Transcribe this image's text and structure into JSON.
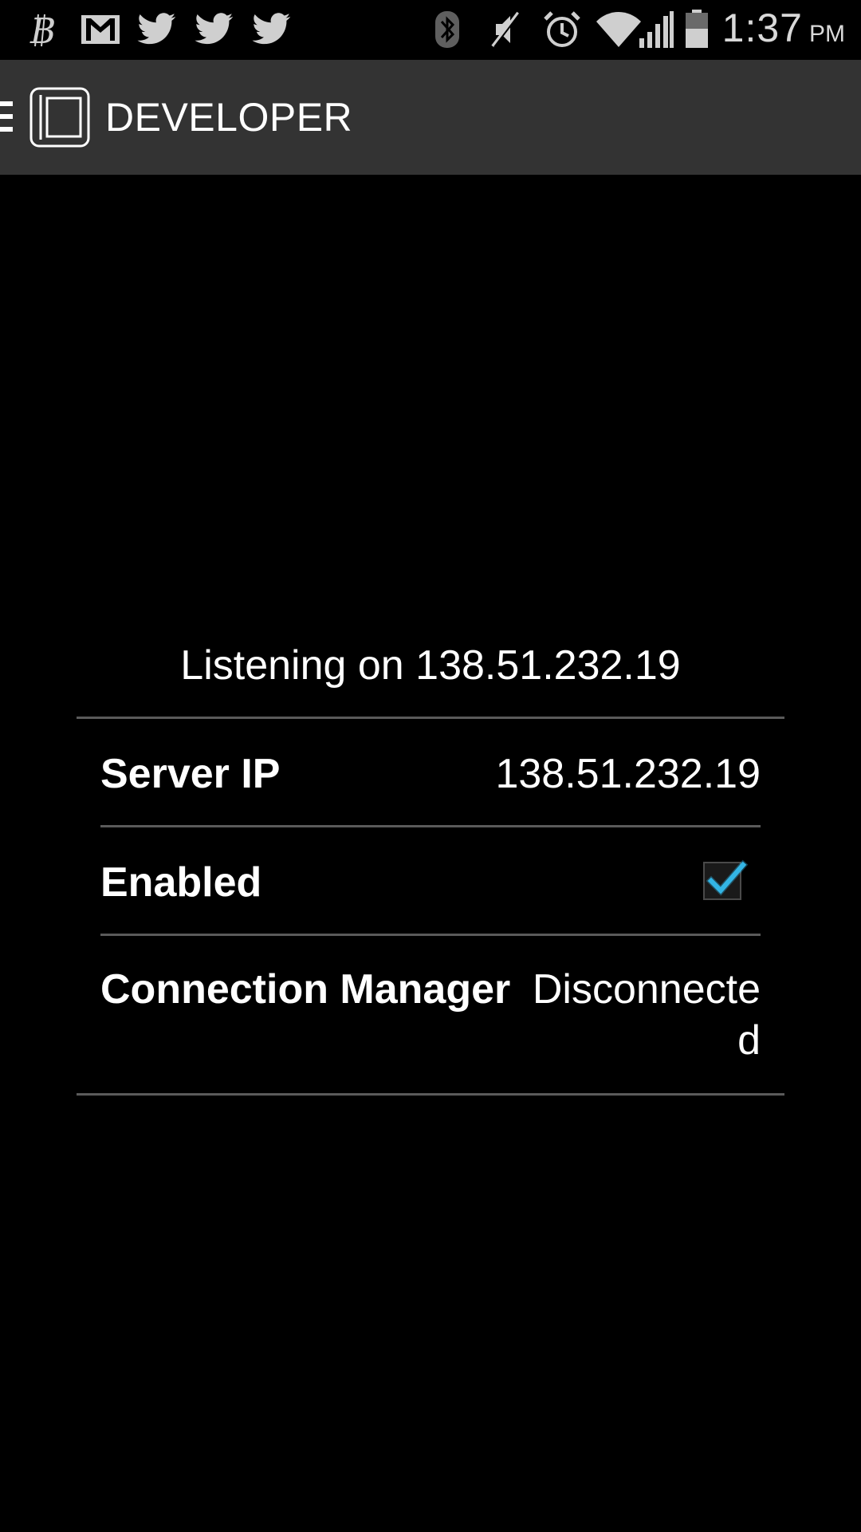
{
  "status_bar": {
    "time": "1:37",
    "ampm": "PM",
    "left_icons": [
      "bitcoin-icon",
      "gmail-icon",
      "twitter-icon",
      "twitter-icon",
      "twitter-icon"
    ],
    "right_icons": [
      "bluetooth-icon",
      "mute-icon",
      "alarm-icon",
      "wifi-icon",
      "signal-icon",
      "battery-icon"
    ]
  },
  "action_bar": {
    "title": "DEVELOPER"
  },
  "main": {
    "listening_text": "Listening on 138.51.232.19",
    "server_ip": {
      "label": "Server IP",
      "value": "138.51.232.19"
    },
    "enabled": {
      "label": "Enabled",
      "checked": true
    },
    "connection_manager": {
      "label": "Connection Manager",
      "value": "Disconnected"
    }
  },
  "colors": {
    "action_bar_bg": "#333333",
    "divider": "#5a5a5a",
    "checkmark": "#33b5e5"
  }
}
